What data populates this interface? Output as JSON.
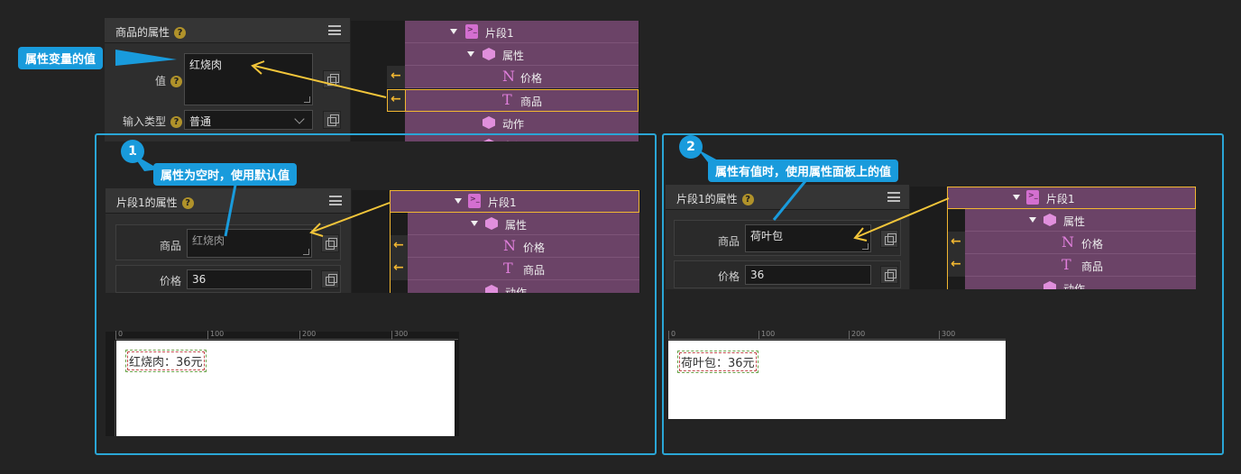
{
  "top": {
    "panel_title": "商品的属性",
    "value_label": "值",
    "value_text": "红烧肉",
    "input_type_label": "输入类型",
    "input_type_value": "普通",
    "callout": "属性变量的值",
    "tree": [
      {
        "label": "片段1",
        "icon": "segment-icon"
      },
      {
        "label": "属性",
        "icon": "box-icon"
      },
      {
        "label": "价格",
        "icon": "number-icon"
      },
      {
        "label": "商品",
        "icon": "text-icon"
      },
      {
        "label": "动作",
        "icon": "box-icon"
      },
      {
        "label": "事件",
        "icon": "box-icon"
      }
    ]
  },
  "example1": {
    "badge": "1",
    "callout": "属性为空时，使用默认值",
    "panel_title": "片段1的属性",
    "field1_label": "商品",
    "field1_placeholder": "红烧肉",
    "field2_label": "价格",
    "field2_value": "36",
    "preview_text": "红烧肉：36元",
    "ruler": [
      "0",
      "100",
      "200",
      "300"
    ],
    "tree": [
      {
        "label": "片段1"
      },
      {
        "label": "属性"
      },
      {
        "label": "价格"
      },
      {
        "label": "商品"
      },
      {
        "label": "动作"
      }
    ]
  },
  "example2": {
    "badge": "2",
    "callout": "属性有值时，使用属性面板上的值",
    "panel_title": "片段1的属性",
    "field1_label": "商品",
    "field1_value": "荷叶包",
    "field2_label": "价格",
    "field2_value": "36",
    "preview_text": "荷叶包：36元",
    "ruler": [
      "0",
      "100",
      "200",
      "300"
    ],
    "tree": [
      {
        "label": "片段1"
      },
      {
        "label": "属性"
      },
      {
        "label": "价格"
      },
      {
        "label": "商品"
      },
      {
        "label": "动作"
      }
    ]
  },
  "colors": {
    "accent": "#199bdc",
    "tree_row": "#6b4367",
    "highlight": "#f2b731"
  }
}
